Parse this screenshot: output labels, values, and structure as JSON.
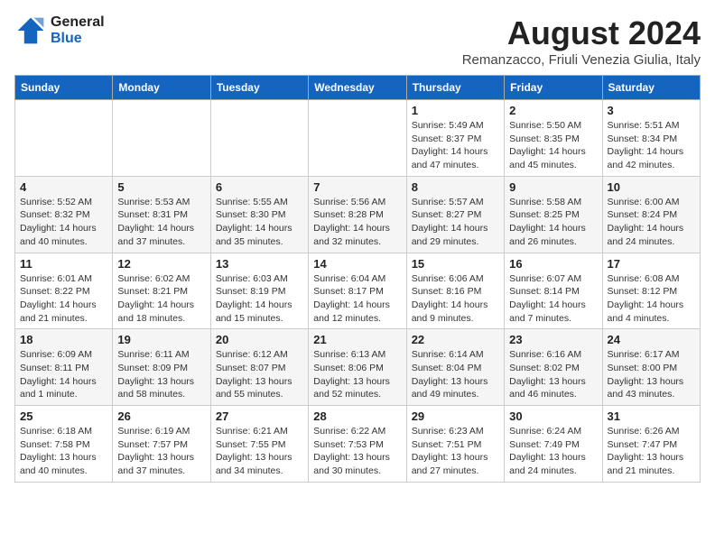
{
  "header": {
    "logo_line1": "General",
    "logo_line2": "Blue",
    "month_year": "August 2024",
    "location": "Remanzacco, Friuli Venezia Giulia, Italy"
  },
  "weekdays": [
    "Sunday",
    "Monday",
    "Tuesday",
    "Wednesday",
    "Thursday",
    "Friday",
    "Saturday"
  ],
  "weeks": [
    [
      {
        "day": "",
        "info": ""
      },
      {
        "day": "",
        "info": ""
      },
      {
        "day": "",
        "info": ""
      },
      {
        "day": "",
        "info": ""
      },
      {
        "day": "1",
        "info": "Sunrise: 5:49 AM\nSunset: 8:37 PM\nDaylight: 14 hours\nand 47 minutes."
      },
      {
        "day": "2",
        "info": "Sunrise: 5:50 AM\nSunset: 8:35 PM\nDaylight: 14 hours\nand 45 minutes."
      },
      {
        "day": "3",
        "info": "Sunrise: 5:51 AM\nSunset: 8:34 PM\nDaylight: 14 hours\nand 42 minutes."
      }
    ],
    [
      {
        "day": "4",
        "info": "Sunrise: 5:52 AM\nSunset: 8:32 PM\nDaylight: 14 hours\nand 40 minutes."
      },
      {
        "day": "5",
        "info": "Sunrise: 5:53 AM\nSunset: 8:31 PM\nDaylight: 14 hours\nand 37 minutes."
      },
      {
        "day": "6",
        "info": "Sunrise: 5:55 AM\nSunset: 8:30 PM\nDaylight: 14 hours\nand 35 minutes."
      },
      {
        "day": "7",
        "info": "Sunrise: 5:56 AM\nSunset: 8:28 PM\nDaylight: 14 hours\nand 32 minutes."
      },
      {
        "day": "8",
        "info": "Sunrise: 5:57 AM\nSunset: 8:27 PM\nDaylight: 14 hours\nand 29 minutes."
      },
      {
        "day": "9",
        "info": "Sunrise: 5:58 AM\nSunset: 8:25 PM\nDaylight: 14 hours\nand 26 minutes."
      },
      {
        "day": "10",
        "info": "Sunrise: 6:00 AM\nSunset: 8:24 PM\nDaylight: 14 hours\nand 24 minutes."
      }
    ],
    [
      {
        "day": "11",
        "info": "Sunrise: 6:01 AM\nSunset: 8:22 PM\nDaylight: 14 hours\nand 21 minutes."
      },
      {
        "day": "12",
        "info": "Sunrise: 6:02 AM\nSunset: 8:21 PM\nDaylight: 14 hours\nand 18 minutes."
      },
      {
        "day": "13",
        "info": "Sunrise: 6:03 AM\nSunset: 8:19 PM\nDaylight: 14 hours\nand 15 minutes."
      },
      {
        "day": "14",
        "info": "Sunrise: 6:04 AM\nSunset: 8:17 PM\nDaylight: 14 hours\nand 12 minutes."
      },
      {
        "day": "15",
        "info": "Sunrise: 6:06 AM\nSunset: 8:16 PM\nDaylight: 14 hours\nand 9 minutes."
      },
      {
        "day": "16",
        "info": "Sunrise: 6:07 AM\nSunset: 8:14 PM\nDaylight: 14 hours\nand 7 minutes."
      },
      {
        "day": "17",
        "info": "Sunrise: 6:08 AM\nSunset: 8:12 PM\nDaylight: 14 hours\nand 4 minutes."
      }
    ],
    [
      {
        "day": "18",
        "info": "Sunrise: 6:09 AM\nSunset: 8:11 PM\nDaylight: 14 hours\nand 1 minute."
      },
      {
        "day": "19",
        "info": "Sunrise: 6:11 AM\nSunset: 8:09 PM\nDaylight: 13 hours\nand 58 minutes."
      },
      {
        "day": "20",
        "info": "Sunrise: 6:12 AM\nSunset: 8:07 PM\nDaylight: 13 hours\nand 55 minutes."
      },
      {
        "day": "21",
        "info": "Sunrise: 6:13 AM\nSunset: 8:06 PM\nDaylight: 13 hours\nand 52 minutes."
      },
      {
        "day": "22",
        "info": "Sunrise: 6:14 AM\nSunset: 8:04 PM\nDaylight: 13 hours\nand 49 minutes."
      },
      {
        "day": "23",
        "info": "Sunrise: 6:16 AM\nSunset: 8:02 PM\nDaylight: 13 hours\nand 46 minutes."
      },
      {
        "day": "24",
        "info": "Sunrise: 6:17 AM\nSunset: 8:00 PM\nDaylight: 13 hours\nand 43 minutes."
      }
    ],
    [
      {
        "day": "25",
        "info": "Sunrise: 6:18 AM\nSunset: 7:58 PM\nDaylight: 13 hours\nand 40 minutes."
      },
      {
        "day": "26",
        "info": "Sunrise: 6:19 AM\nSunset: 7:57 PM\nDaylight: 13 hours\nand 37 minutes."
      },
      {
        "day": "27",
        "info": "Sunrise: 6:21 AM\nSunset: 7:55 PM\nDaylight: 13 hours\nand 34 minutes."
      },
      {
        "day": "28",
        "info": "Sunrise: 6:22 AM\nSunset: 7:53 PM\nDaylight: 13 hours\nand 30 minutes."
      },
      {
        "day": "29",
        "info": "Sunrise: 6:23 AM\nSunset: 7:51 PM\nDaylight: 13 hours\nand 27 minutes."
      },
      {
        "day": "30",
        "info": "Sunrise: 6:24 AM\nSunset: 7:49 PM\nDaylight: 13 hours\nand 24 minutes."
      },
      {
        "day": "31",
        "info": "Sunrise: 6:26 AM\nSunset: 7:47 PM\nDaylight: 13 hours\nand 21 minutes."
      }
    ]
  ]
}
